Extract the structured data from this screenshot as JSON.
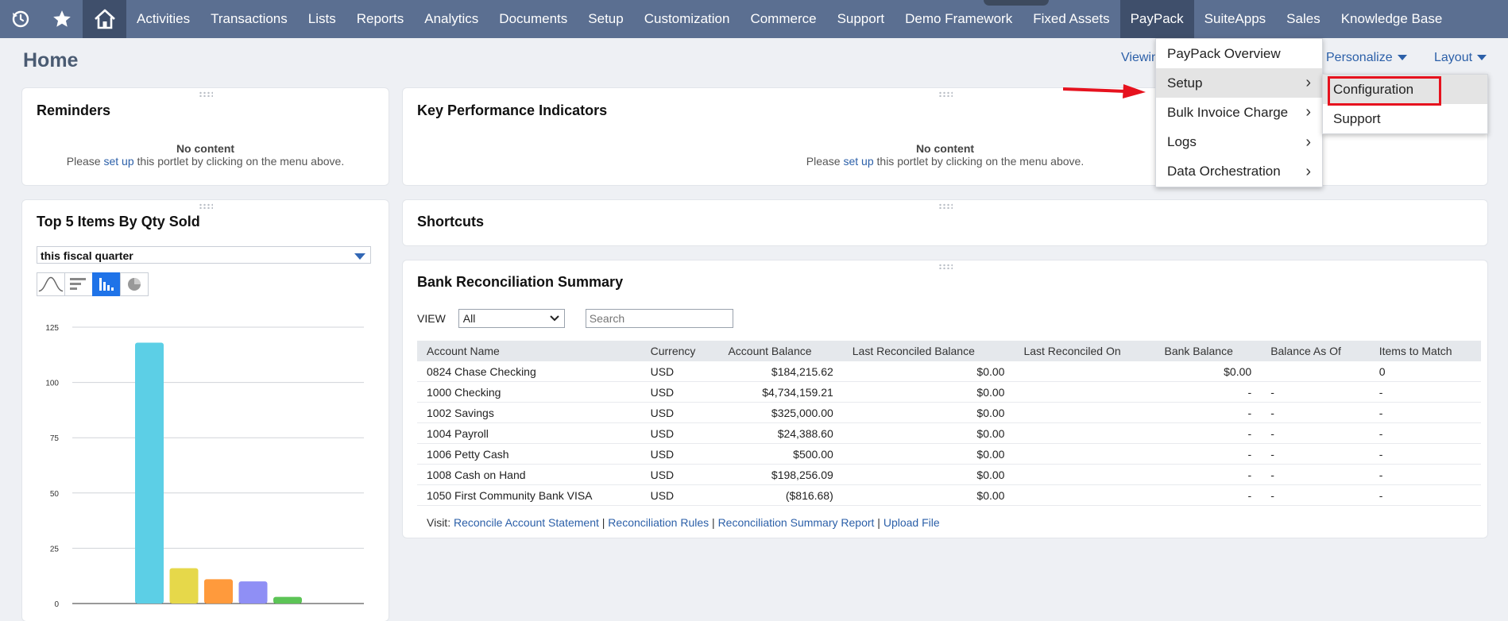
{
  "nav": {
    "icons": [
      "recent-history-icon",
      "star-icon",
      "home-icon"
    ],
    "tabs": [
      "Activities",
      "Transactions",
      "Lists",
      "Reports",
      "Analytics",
      "Documents",
      "Setup",
      "Customization",
      "Commerce",
      "Support",
      "Demo Framework",
      "Fixed Assets",
      "PayPack",
      "SuiteApps",
      "Sales",
      "Knowledge Base"
    ],
    "active_tab": "PayPack"
  },
  "header": {
    "title": "Home",
    "viewing_label": "Viewin",
    "personalize_label": "Personalize",
    "layout_label": "Layout"
  },
  "reminders": {
    "title": "Reminders",
    "no_content": "No content",
    "msg_prefix": "Please",
    "msg_link": "set up",
    "msg_suffix": "this portlet by clicking on the menu above."
  },
  "kpi": {
    "title": "Key Performance Indicators",
    "no_content": "No content",
    "msg_prefix": "Please",
    "msg_link": "set up",
    "msg_suffix": "this portlet by clicking on the menu above."
  },
  "top5": {
    "title": "Top 5 Items By Qty Sold",
    "period": "this fiscal quarter",
    "chart_type_icons": [
      "line-chart-icon",
      "horizontal-bar-chart-icon",
      "column-chart-icon",
      "pie-chart-icon"
    ],
    "selected_chart_type": "column-chart-icon"
  },
  "chart_data": {
    "type": "bar",
    "categories": [
      "",
      "",
      "",
      "",
      ""
    ],
    "values": [
      118,
      16,
      11,
      10,
      3
    ],
    "colors": [
      "#5ccfe6",
      "#e6d84a",
      "#ff9a3c",
      "#8f8ff5",
      "#5cc456"
    ],
    "yticks": [
      0,
      25,
      50,
      75,
      100,
      125
    ],
    "ylim": [
      0,
      125
    ],
    "grid": true
  },
  "shortcuts": {
    "title": "Shortcuts"
  },
  "bank": {
    "title": "Bank Reconciliation Summary",
    "view_label": "VIEW",
    "view_value": "All",
    "search_placeholder": "Search",
    "columns": [
      "Account Name",
      "Currency",
      "Account Balance",
      "Last Reconciled Balance",
      "Last Reconciled On",
      "Bank Balance",
      "Balance As Of",
      "Items to Match"
    ],
    "rows": [
      [
        "0824 Chase Checking",
        "USD",
        "$184,215.62",
        "$0.00",
        "",
        "$0.00",
        "",
        "0"
      ],
      [
        "1000 Checking",
        "USD",
        "$4,734,159.21",
        "$0.00",
        "",
        "-",
        "-",
        "-"
      ],
      [
        "1002 Savings",
        "USD",
        "$325,000.00",
        "$0.00",
        "",
        "-",
        "-",
        "-"
      ],
      [
        "1004 Payroll",
        "USD",
        "$24,388.60",
        "$0.00",
        "",
        "-",
        "-",
        "-"
      ],
      [
        "1006 Petty Cash",
        "USD",
        "$500.00",
        "$0.00",
        "",
        "-",
        "-",
        "-"
      ],
      [
        "1008 Cash on Hand",
        "USD",
        "$198,256.09",
        "$0.00",
        "",
        "-",
        "-",
        "-"
      ],
      [
        "1050 First Community Bank VISA",
        "USD",
        "($816.68)",
        "$0.00",
        "",
        "-",
        "-",
        "-"
      ]
    ],
    "visit_label": "Visit:",
    "visit_links": [
      "Reconcile Account Statement",
      "Reconciliation Rules",
      "Reconciliation Summary Report",
      "Upload File"
    ]
  },
  "paypack_menu": {
    "items": [
      "PayPack Overview",
      "Setup",
      "Bulk Invoice Charge",
      "Logs",
      "Data Orchestration"
    ],
    "has_submenu": [
      false,
      true,
      true,
      true,
      true
    ],
    "hovered": "Setup"
  },
  "setup_submenu": {
    "items": [
      "Configuration",
      "Support"
    ],
    "highlighted": "Configuration"
  },
  "annotation_color": "#e6121e"
}
